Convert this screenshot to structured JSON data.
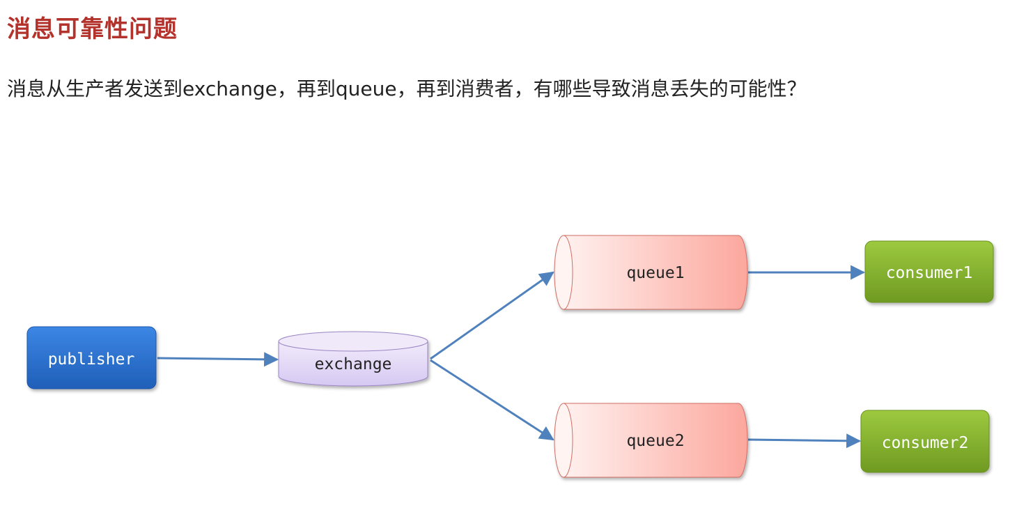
{
  "title": "消息可靠性问题",
  "question": "消息从生产者发送到exchange，再到queue，再到消费者，有哪些导致消息丢失的可能性？",
  "diagram": {
    "publisher": {
      "label": "publisher",
      "color": "#2a6fd1"
    },
    "exchange": {
      "label": "exchange",
      "color": "#d9cdf3"
    },
    "queues": [
      {
        "label": "queue1",
        "color": "#fcb6ae"
      },
      {
        "label": "queue2",
        "color": "#fcb6ae"
      }
    ],
    "consumers": [
      {
        "label": "consumer1",
        "color": "#86b530"
      },
      {
        "label": "consumer2",
        "color": "#86b530"
      }
    ],
    "edges": [
      {
        "from": "publisher",
        "to": "exchange"
      },
      {
        "from": "exchange",
        "to": "queue1"
      },
      {
        "from": "exchange",
        "to": "queue2"
      },
      {
        "from": "queue1",
        "to": "consumer1"
      },
      {
        "from": "queue2",
        "to": "consumer2"
      }
    ],
    "arrow_color": "#4f81bd"
  }
}
